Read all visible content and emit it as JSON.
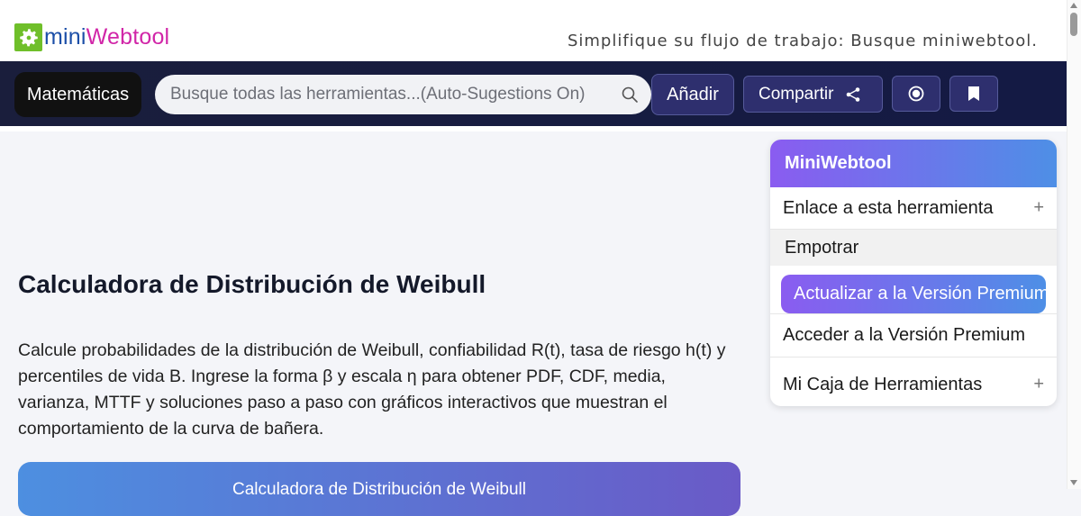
{
  "header": {
    "logo_part1": "mini",
    "logo_part2": "Webtool",
    "tagline": "Simplifique su flujo de trabajo: Busque miniwebtool."
  },
  "nav": {
    "category_label": "Matemáticas",
    "search_placeholder": "Busque todas las herramientas...(Auto-Sugestions On)",
    "add_label": "Añadir",
    "share_label": "Compartir",
    "icons": [
      "search-icon",
      "share-icon",
      "target-circle-icon",
      "bookmark-icon"
    ]
  },
  "main": {
    "title": "Calculadora de Distribución de Weibull",
    "description": "Calcule probabilidades de la distribución de Weibull, confiabilidad R(t), tasa de riesgo h(t) y percentiles de vida B. Ingrese la forma β y escala η para obtener PDF, CDF, media, varianza, MTTF y soluciones paso a paso con gráficos interactivos que muestran el comportamiento de la curva de bañera.",
    "card_title": "Calculadora de Distribución de Weibull"
  },
  "panel": {
    "title": "MiniWebtool",
    "items": [
      {
        "label": "Enlace a esta herramienta",
        "expand": "+"
      },
      {
        "label": "Empotrar"
      },
      {
        "label": "Actualizar a la Versión Premium"
      },
      {
        "label": "Acceder a la Versión Premium"
      },
      {
        "label": "Mi Caja de Herramientas",
        "expand": "+"
      }
    ]
  },
  "colors": {
    "nav_bg": "#1a1e3c",
    "accent_purple": "#8a5cf0",
    "accent_blue": "#4e8fe6",
    "logo_green": "#6fbf2a",
    "logo_blue": "#1c4fa8",
    "logo_pink": "#d126a8"
  }
}
